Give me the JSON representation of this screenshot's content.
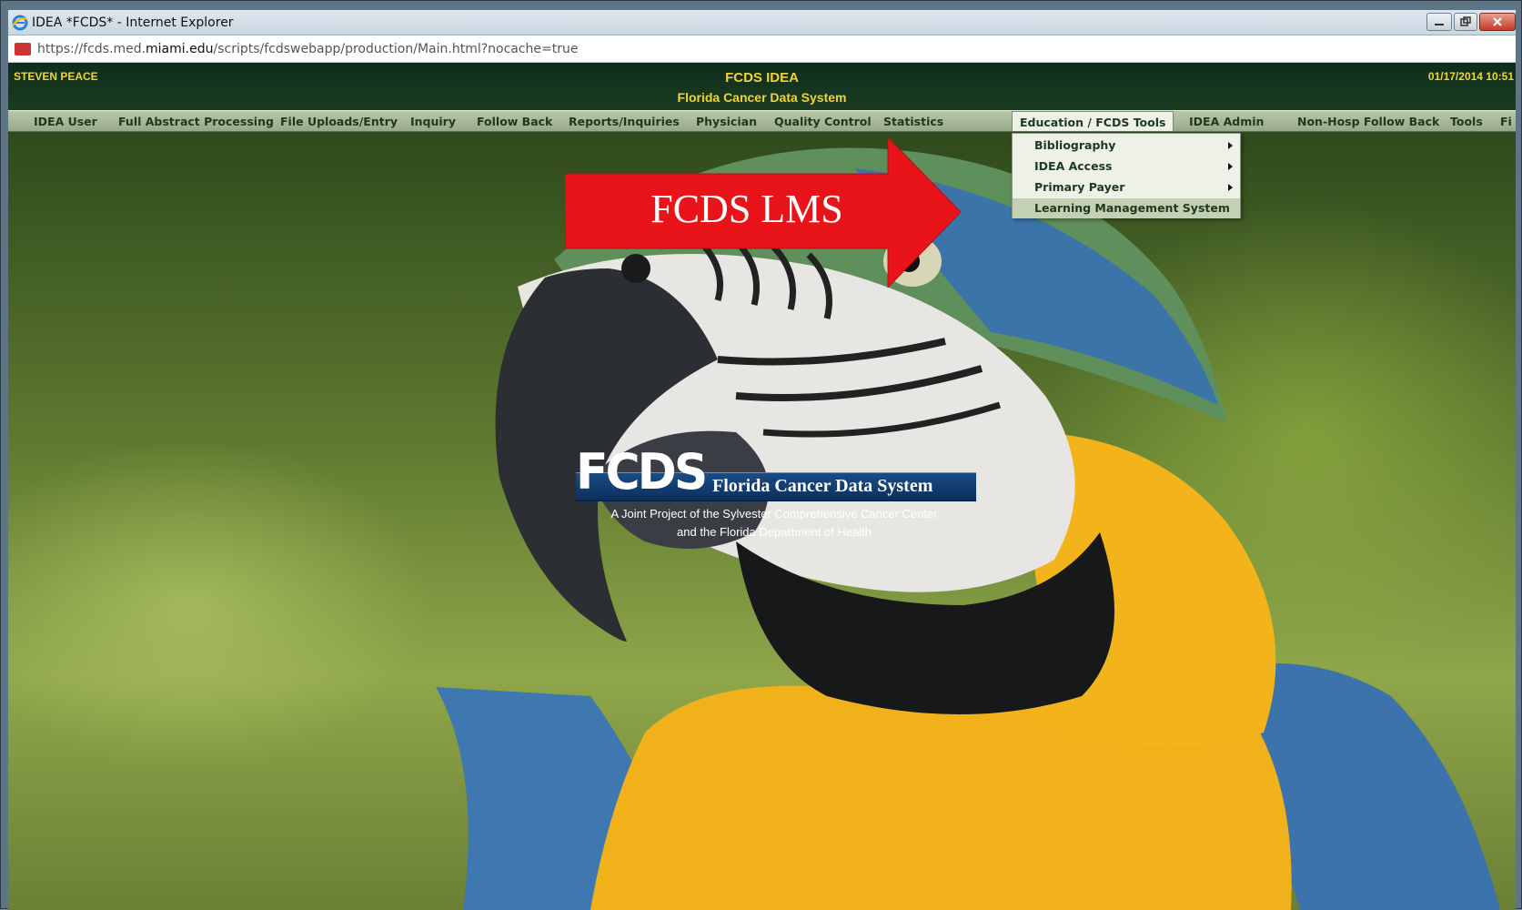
{
  "window": {
    "title": "IDEA *FCDS* - Internet Explorer",
    "address_url_prefix": "https://fcds.med.",
    "address_url_domain": "miami.edu",
    "address_url_path": "/scripts/fcdswebapp/production/Main.html?nocache=true"
  },
  "header": {
    "user": "STEVEN PEACE",
    "title": "FCDS IDEA",
    "subtitle": "Florida Cancer Data System",
    "datetime": "01/17/2014 10:51"
  },
  "menu": {
    "items": [
      {
        "label": "IDEA User"
      },
      {
        "label": "Full Abstract Processing"
      },
      {
        "label": "File Uploads/Entry"
      },
      {
        "label": "Inquiry"
      },
      {
        "label": "Follow Back"
      },
      {
        "label": "Reports/Inquiries"
      },
      {
        "label": "Physician"
      },
      {
        "label": "Quality Control"
      },
      {
        "label": "Statistics"
      },
      {
        "label": "Education / FCDS Tools"
      },
      {
        "label": "IDEA Admin"
      },
      {
        "label": "Non-Hosp Follow Back"
      },
      {
        "label": "Tools"
      },
      {
        "label": "Fi"
      }
    ],
    "active_index": 9
  },
  "dropdown": {
    "items": [
      {
        "label": "Bibliography",
        "has_submenu": true
      },
      {
        "label": "IDEA Access",
        "has_submenu": true
      },
      {
        "label": "Primary Payer",
        "has_submenu": true
      },
      {
        "label": "Learning Management System",
        "has_submenu": false
      }
    ]
  },
  "annotation": {
    "label": "FCDS LMS",
    "color": "#e8141a"
  },
  "logo": {
    "mark": "FCDS",
    "name": "Florida Cancer Data System",
    "tagline_line1": "A Joint Project of the Sylvester Comprehensive Cancer Center",
    "tagline_line2": "and the Florida Department of Health"
  },
  "colors": {
    "header_text": "#f3d233",
    "menu_text": "#1e3a1e",
    "logo_blue": "#0b2f5c"
  }
}
